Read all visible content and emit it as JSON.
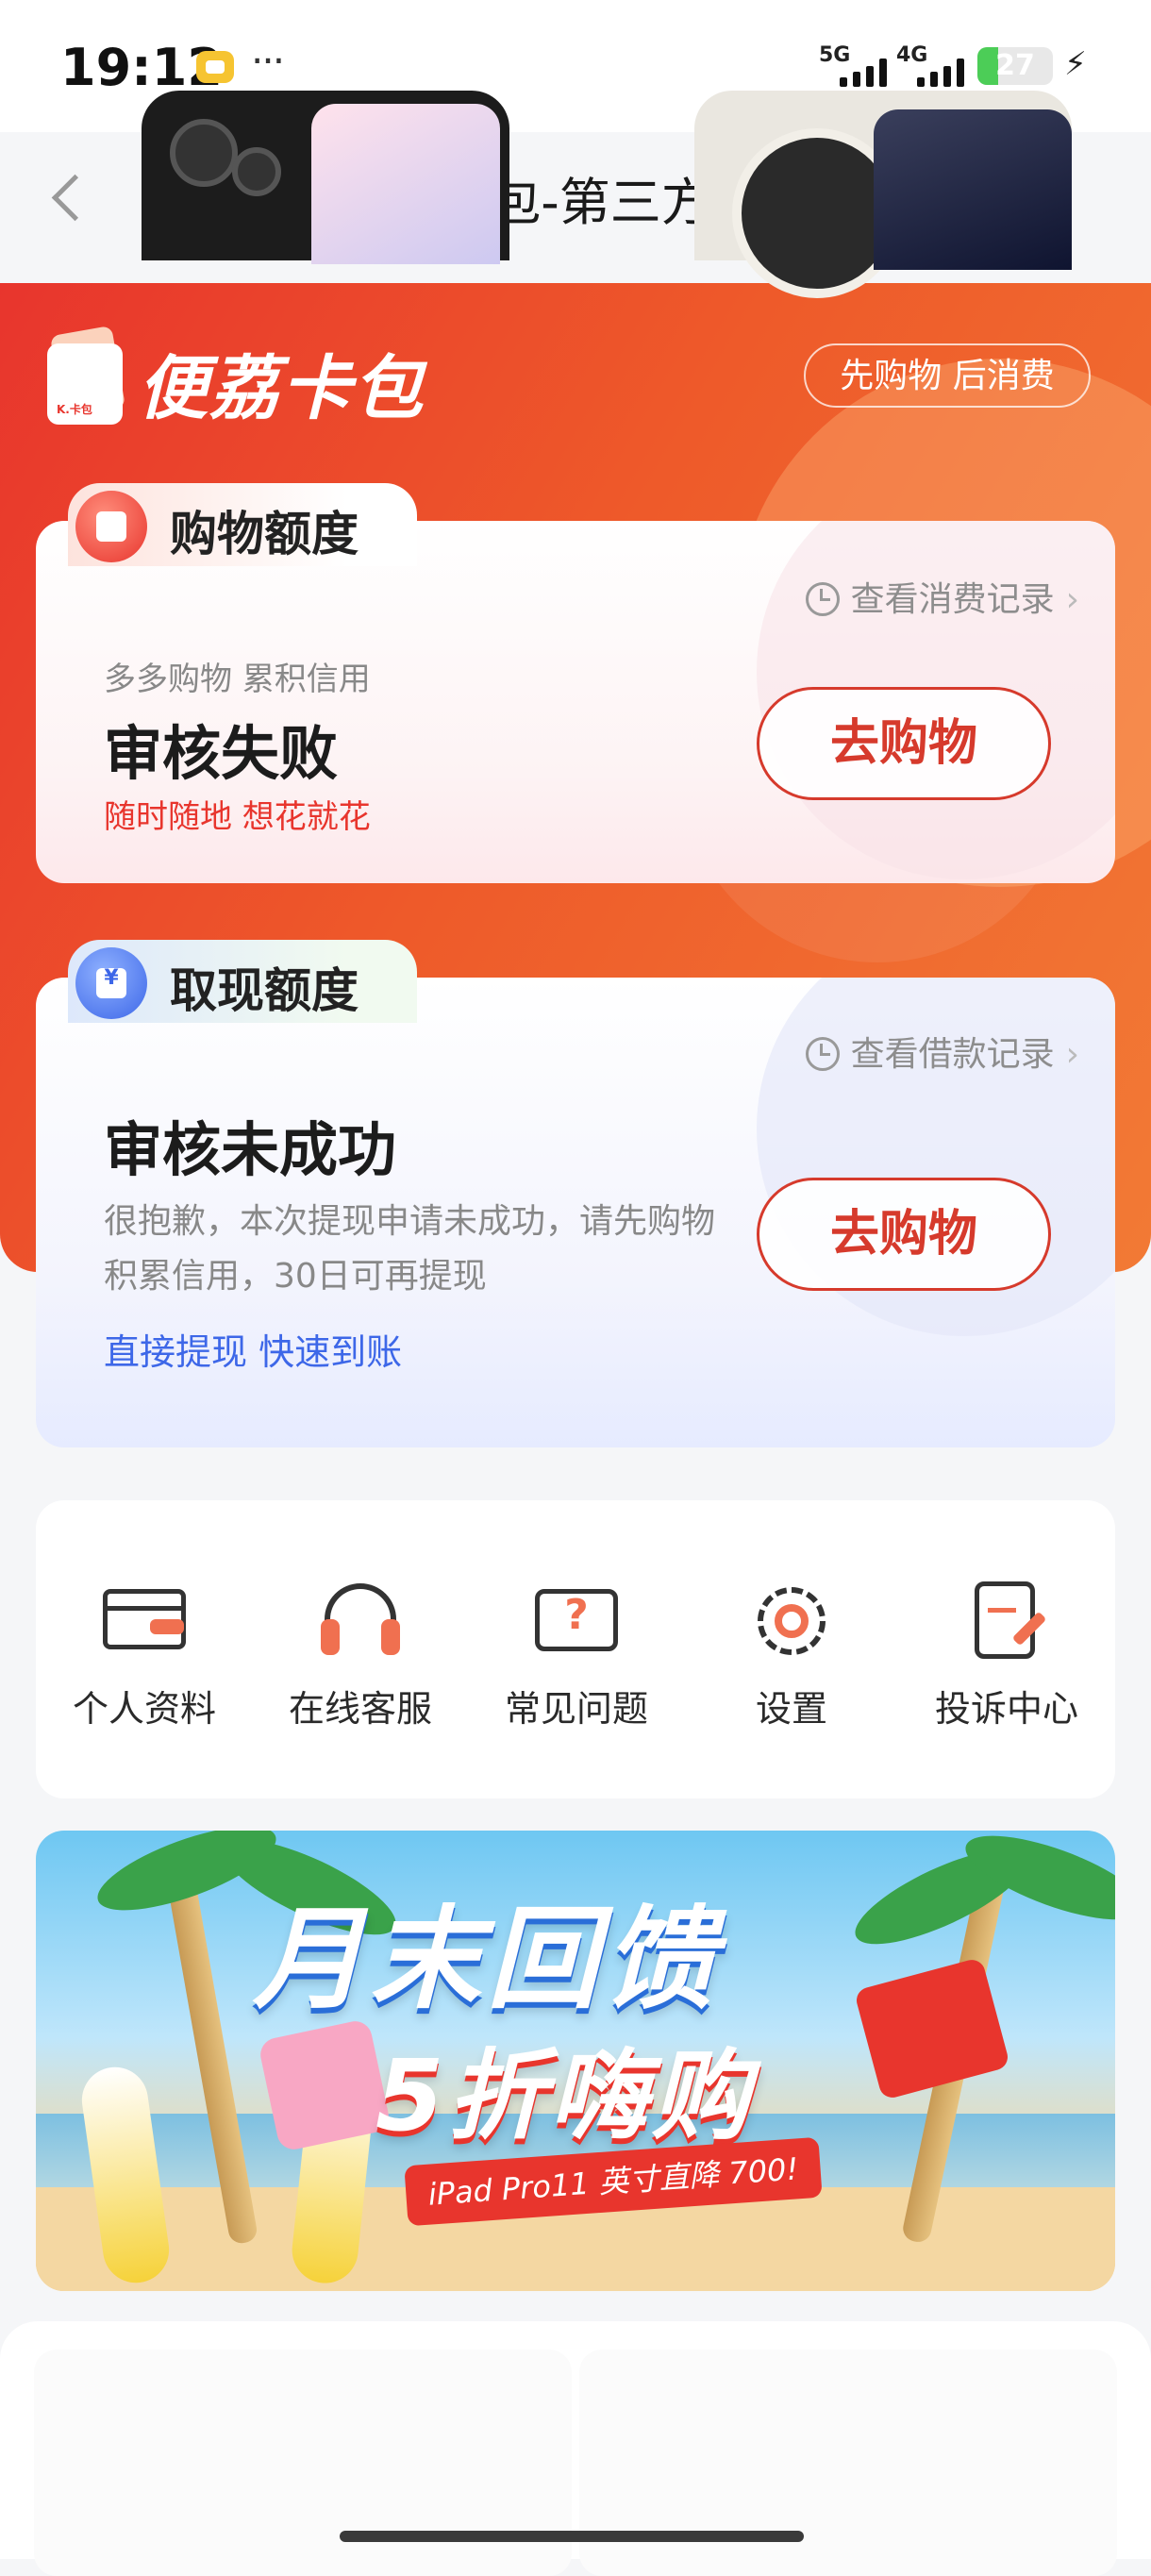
{
  "status_bar": {
    "time": "19:12",
    "signal1": "5G",
    "signal2": "4G",
    "battery": "27",
    "battery_level": 0.27
  },
  "nav": {
    "title": "便荔卡包-第三方服务"
  },
  "brand": {
    "name": "便荔卡包",
    "slogan": "先购物 后消费"
  },
  "shopping": {
    "badge": "购物额度",
    "record_link": "查看消费记录",
    "hint": "多多购物 累积信用",
    "status": "审核失败",
    "tag": "随时随地 想花就花",
    "button": "去购物"
  },
  "cash": {
    "badge": "取现额度",
    "record_link": "查看借款记录",
    "status": "审核未成功",
    "desc": "很抱歉，本次提现申请未成功，请先购物积累信用，30日可再提现",
    "tag": "直接提现 快速到账",
    "button": "去购物"
  },
  "services": [
    {
      "label": "个人资料",
      "icon": "id-card-icon"
    },
    {
      "label": "在线客服",
      "icon": "headset-icon"
    },
    {
      "label": "常见问题",
      "icon": "question-chat-icon"
    },
    {
      "label": "设置",
      "icon": "gear-icon"
    },
    {
      "label": "投诉中心",
      "icon": "complaint-doc-icon"
    }
  ],
  "promo": {
    "title": "月末回馈",
    "subtitle": "5折嗨购",
    "ribbon": "iPad Pro11 英寸直降 700!"
  },
  "colors": {
    "brand_red": "#e8352d",
    "brand_orange": "#f27a35",
    "link_blue": "#3d67e8",
    "page_bg": "#f5f6f8"
  }
}
